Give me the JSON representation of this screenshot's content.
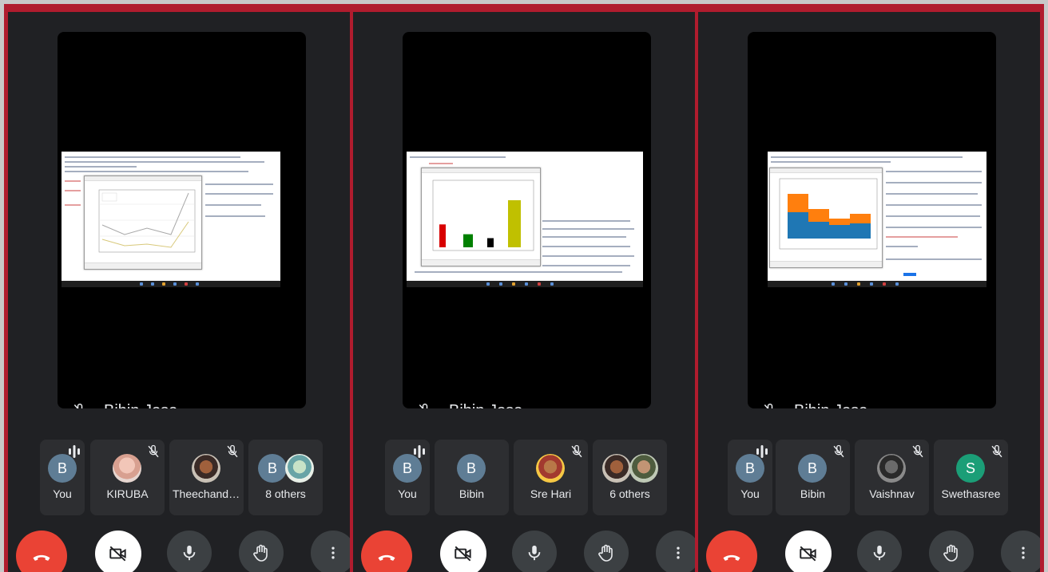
{
  "panels": [
    {
      "speaker": {
        "name": "Bibin Jose"
      },
      "tiles": [
        {
          "name": "You",
          "initial": "B"
        },
        {
          "name": "KIRUBA"
        },
        {
          "name": "Theechandran"
        },
        {
          "name": "8 others",
          "initial": "B"
        }
      ],
      "chart": {
        "type": "line"
      }
    },
    {
      "speaker": {
        "name": "Bibin Jose"
      },
      "tiles": [
        {
          "name": "You",
          "initial": "B"
        },
        {
          "name": "Bibin",
          "initial": "B"
        },
        {
          "name": "Sre Hari"
        },
        {
          "name": "6 others"
        }
      ],
      "chart": {
        "type": "bar",
        "colors": [
          "#d80000",
          "#008000",
          "#000000",
          "#c0c000"
        ],
        "values": [
          0.35,
          0.2,
          0.14,
          0.72
        ]
      }
    },
    {
      "speaker": {
        "name": "Bibin Jose"
      },
      "tiles": [
        {
          "name": "You",
          "initial": "B"
        },
        {
          "name": "Bibin",
          "initial": "B"
        },
        {
          "name": "Vaishnav"
        },
        {
          "name": "Swethasree",
          "initial": "S"
        }
      ],
      "chart": {
        "type": "stacked-bar",
        "colors": [
          "#1f77b4",
          "#ff7f0e"
        ]
      }
    }
  ],
  "icons": {
    "end_call": "call-end-icon",
    "camera": "videocam-off-icon",
    "mic": "mic-icon",
    "hand": "raise-hand-icon",
    "more": "more-vert-icon",
    "mic_muted": "mic-off-icon",
    "speaking": "audio-bars-icon"
  },
  "colors": {
    "frame": "#b01c2e",
    "panel_bg": "#202124",
    "tile_bg": "#2d2e31",
    "end_call": "#ea4335",
    "control_bg": "#3c4043"
  }
}
